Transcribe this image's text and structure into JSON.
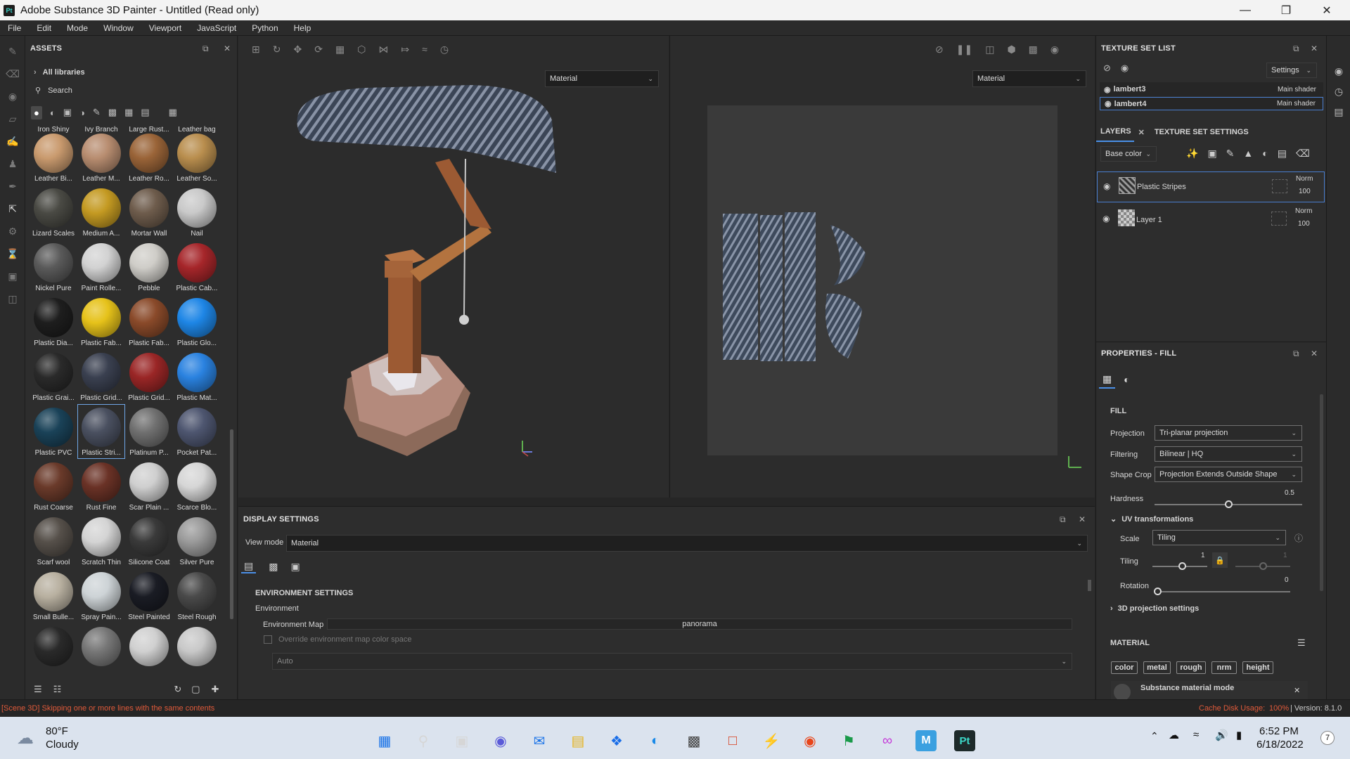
{
  "app": {
    "title": "Adobe Substance 3D Painter - Untitled (Read only)",
    "logo": "Pt"
  },
  "menu": [
    "File",
    "Edit",
    "Mode",
    "Window",
    "Viewport",
    "JavaScript",
    "Python",
    "Help"
  ],
  "assets": {
    "title": "ASSETS",
    "library": "All libraries",
    "search_placeholder": "Search",
    "top_row": [
      "Iron Shiny",
      "Ivy Branch",
      "Large Rust...",
      "Leather bag"
    ],
    "items": [
      {
        "name": "Leather Bi...",
        "color": "#c99a6e"
      },
      {
        "name": "Leather M...",
        "color": "#b88d70"
      },
      {
        "name": "Leather Ro...",
        "color": "#9a6438"
      },
      {
        "name": "Leather So...",
        "color": "#b98e4e"
      },
      {
        "name": "Lizard Scales",
        "color": "#4a4a44"
      },
      {
        "name": "Medium A...",
        "color": "#c49a22"
      },
      {
        "name": "Mortar Wall",
        "color": "#6e5c4c"
      },
      {
        "name": "Nail",
        "color": "#c9c9c9"
      },
      {
        "name": "Nickel Pure",
        "color": "#5a5a5a"
      },
      {
        "name": "Paint Rolle...",
        "color": "#d2d2d2"
      },
      {
        "name": "Pebble",
        "color": "#cfcdc8"
      },
      {
        "name": "Plastic Cab...",
        "color": "#a6262a"
      },
      {
        "name": "Plastic Dia...",
        "color": "#1e1e1e"
      },
      {
        "name": "Plastic Fab...",
        "color": "#e6c21a"
      },
      {
        "name": "Plastic Fab...",
        "color": "#8a4a2a"
      },
      {
        "name": "Plastic Glo...",
        "color": "#1e86e6"
      },
      {
        "name": "Plastic Grai...",
        "color": "#2a2a2a"
      },
      {
        "name": "Plastic Grid...",
        "color": "#3a4050"
      },
      {
        "name": "Plastic Grid...",
        "color": "#9a2626"
      },
      {
        "name": "Plastic Mat...",
        "color": "#2a82e0"
      },
      {
        "name": "Plastic PVC",
        "color": "#1a4258"
      },
      {
        "name": "Plastic Stri...",
        "color": "#4a5060"
      },
      {
        "name": "Platinum P...",
        "color": "#707070"
      },
      {
        "name": "Pocket Pat...",
        "color": "#4e5670"
      },
      {
        "name": "Rust Coarse",
        "color": "#6a3a2a"
      },
      {
        "name": "Rust Fine",
        "color": "#6a3226"
      },
      {
        "name": "Scar Plain ...",
        "color": "#cfcfcf"
      },
      {
        "name": "Scarce Blo...",
        "color": "#d6d6d6"
      },
      {
        "name": "Scarf wool",
        "color": "#56504a"
      },
      {
        "name": "Scratch Thin",
        "color": "#d4d4d4"
      },
      {
        "name": "Silicone Coat",
        "color": "#3a3a3a"
      },
      {
        "name": "Silver Pure",
        "color": "#9a9a9a"
      },
      {
        "name": "Small Bulle...",
        "color": "#b8b0a0"
      },
      {
        "name": "Spray Pain...",
        "color": "#cdd3d6"
      },
      {
        "name": "Steel Painted",
        "color": "#1a1c24"
      },
      {
        "name": "Steel Rough",
        "color": "#4a4a4a"
      },
      {
        "name": "",
        "color": "#2a2a2a"
      },
      {
        "name": "",
        "color": "#777777"
      },
      {
        "name": "",
        "color": "#d0d0d0"
      },
      {
        "name": "",
        "color": "#c8c8c8"
      }
    ],
    "selected_index": 21
  },
  "viewport": {
    "left_mode": "Material",
    "right_mode": "Material"
  },
  "texture_set_list": {
    "title": "TEXTURE SET LIST",
    "settings_label": "Settings",
    "sets": [
      {
        "name": "lambert3",
        "shader": "Main shader"
      },
      {
        "name": "lambert4",
        "shader": "Main shader"
      }
    ]
  },
  "layers": {
    "tab_layers": "LAYERS",
    "tab_settings": "TEXTURE SET SETTINGS",
    "channel": "Base color",
    "items": [
      {
        "name": "Plastic Stripes",
        "blend": "Norm",
        "opacity": "100"
      },
      {
        "name": "Layer 1",
        "blend": "Norm",
        "opacity": "100"
      }
    ]
  },
  "properties": {
    "title": "PROPERTIES - FILL",
    "fill_heading": "FILL",
    "projection_label": "Projection",
    "projection_value": "Tri-planar projection",
    "filtering_label": "Filtering",
    "filtering_value": "Bilinear | HQ",
    "shapecrop_label": "Shape Crop",
    "shapecrop_value": "Projection Extends Outside Shape",
    "hardness_label": "Hardness",
    "hardness_value": "0.5",
    "hardness_fraction": 0.5,
    "uv_heading": "UV transformations",
    "scale_label": "Scale",
    "scale_value": "Tiling",
    "tiling_label": "Tiling",
    "tiling_value": "1",
    "tiling_value2": "1",
    "rotation_label": "Rotation",
    "rotation_value": "0",
    "proj3d_heading": "3D projection settings",
    "material_heading": "MATERIAL",
    "channels": [
      "color",
      "metal",
      "rough",
      "nrm",
      "height"
    ],
    "material_mode": "Substance material mode"
  },
  "display": {
    "title": "DISPLAY SETTINGS",
    "viewmode_label": "View mode",
    "viewmode_value": "Material",
    "env_heading": "ENVIRONMENT SETTINGS",
    "env_label": "Environment",
    "envmap_label": "Environment Map",
    "envmap_value": "panorama",
    "override_label": "Override environment map color space",
    "colorspace_value": "Auto"
  },
  "status": {
    "message": "[Scene 3D] Skipping one or more lines with the same contents",
    "cache_label": "Cache Disk Usage:",
    "cache_value": "100%",
    "version": "| Version: 8.1.0"
  },
  "taskbar": {
    "temp": "80°F",
    "weather": "Cloudy",
    "time": "6:52 PM",
    "date": "6/18/2022",
    "notif": "7"
  }
}
